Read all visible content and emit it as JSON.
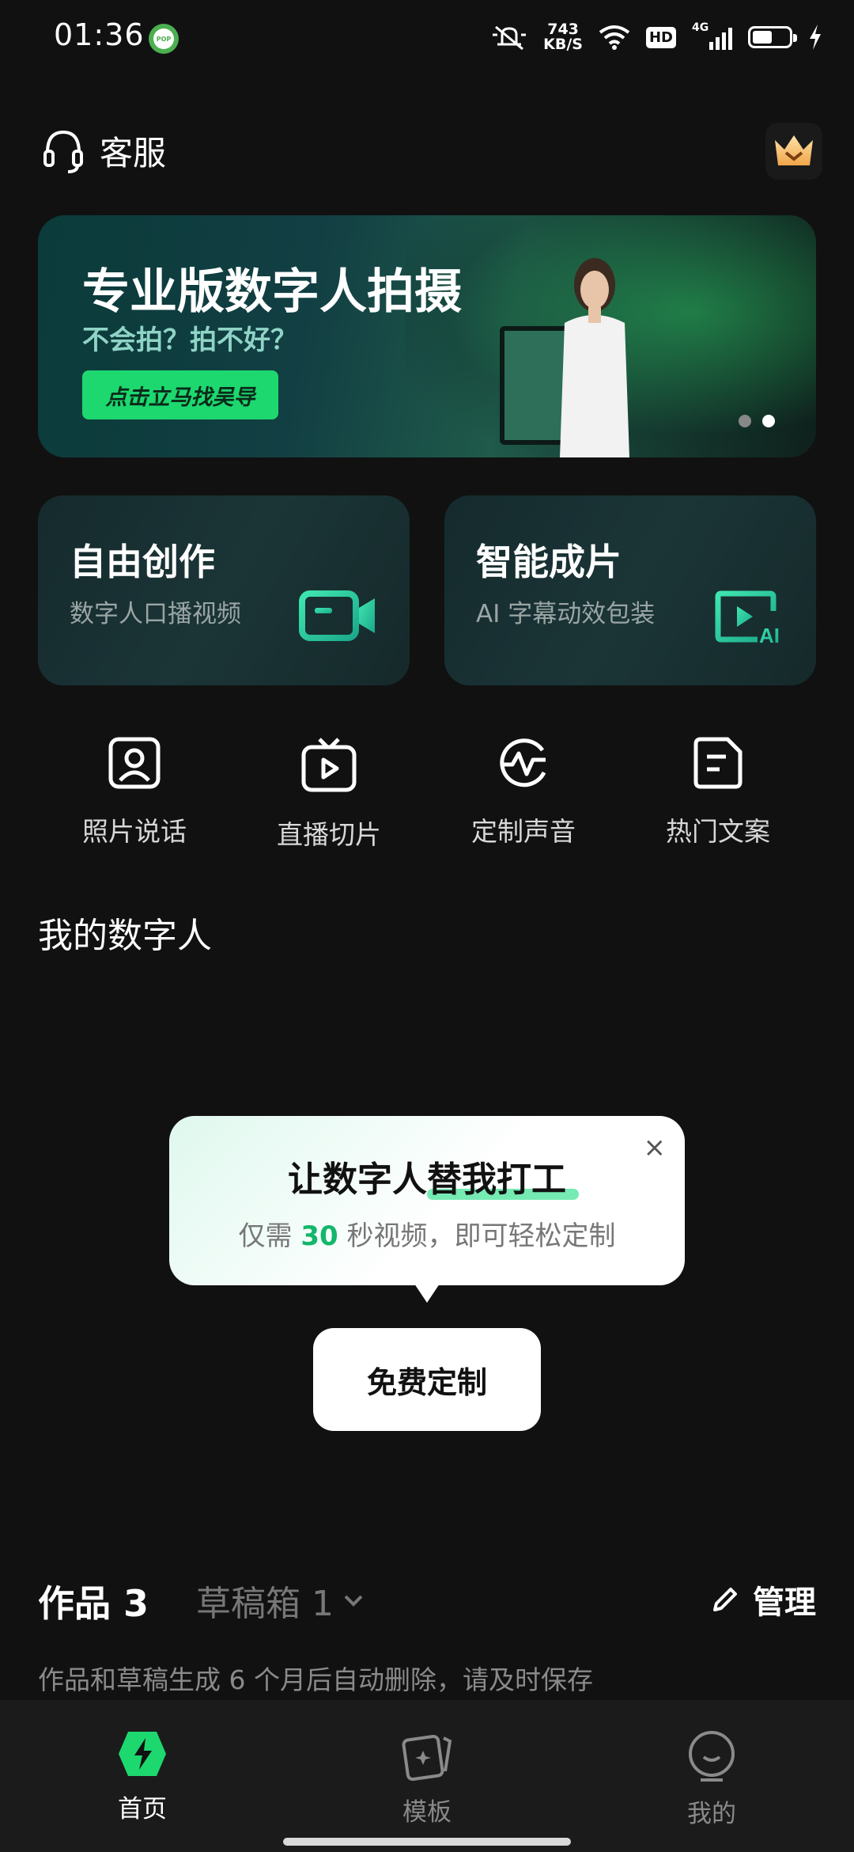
{
  "status_bar": {
    "time": "01:36",
    "pop_badge": "POP",
    "net_speed_value": "743",
    "net_speed_unit": "KB/S",
    "hd": "HD",
    "network": "4G"
  },
  "header": {
    "service_label": "客服"
  },
  "banner": {
    "title": "专业版数字人拍摄",
    "subtitle": "不会拍？拍不好？",
    "cta": "点击立马找吴导",
    "pages": 2,
    "active_page": 2
  },
  "cards": [
    {
      "title": "自由创作",
      "subtitle": "数字人口播视频",
      "icon": "video-camera-icon"
    },
    {
      "title": "智能成片",
      "subtitle": "AI 字幕动效包装",
      "icon": "ai-play-icon"
    }
  ],
  "quick_actions": [
    {
      "label": "照片说话",
      "icon": "portrait-icon"
    },
    {
      "label": "直播切片",
      "icon": "tv-play-icon"
    },
    {
      "label": "定制声音",
      "icon": "voice-wave-icon"
    },
    {
      "label": "热门文案",
      "icon": "document-icon"
    }
  ],
  "my_digital_human": {
    "title": "我的数字人"
  },
  "tooltip": {
    "title": "让数字人替我打工",
    "sub_prefix": "仅需 ",
    "sub_number": "30",
    "sub_suffix": " 秒视频，即可轻松定制",
    "close": "×"
  },
  "free_button": "免费定制",
  "works": {
    "label": "作品 3",
    "drafts": "草稿箱 1",
    "manage": "管理",
    "notice": "作品和草稿生成 6 个月后自动删除，请及时保存"
  },
  "nav": [
    {
      "label": "首页",
      "icon": "lightning-home-icon",
      "active": true
    },
    {
      "label": "模板",
      "icon": "template-cards-icon",
      "active": false
    },
    {
      "label": "我的",
      "icon": "profile-face-icon",
      "active": false
    }
  ],
  "colors": {
    "background": "#111112",
    "accent": "#1dd86f",
    "card": "#1b3537",
    "teal_icon": "#2ed3a6"
  }
}
